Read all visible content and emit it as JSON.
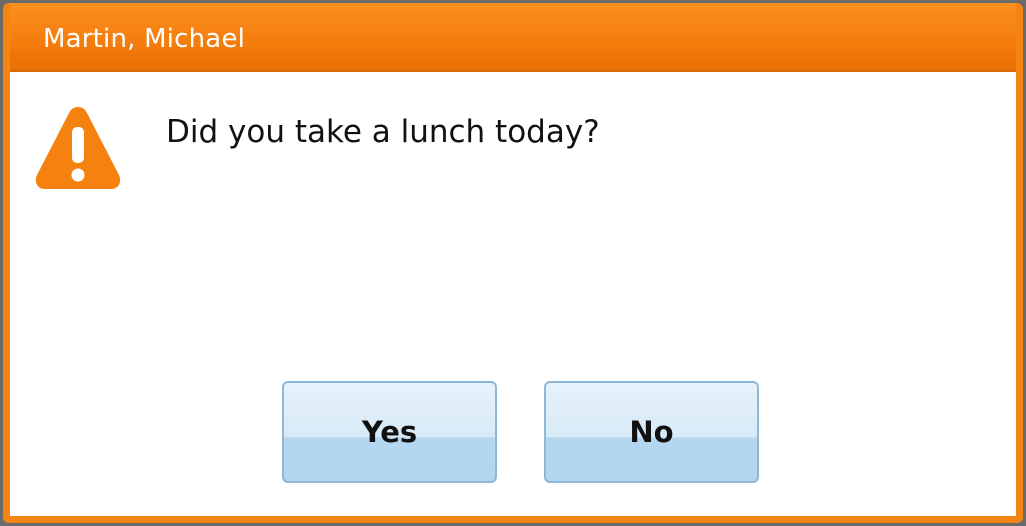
{
  "dialog": {
    "title": "Martin, Michael",
    "message": "Did you take a lunch today?",
    "icon": "warning-icon",
    "yes_label": "Yes",
    "no_label": "No"
  },
  "colors": {
    "accent": "#f58512",
    "button_fill": "#b4d6ee",
    "button_border": "#8fb8d8",
    "background": "#ffffff"
  }
}
